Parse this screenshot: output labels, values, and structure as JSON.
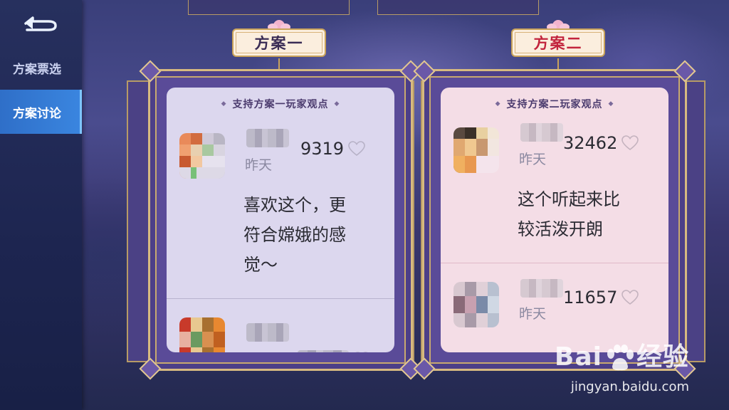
{
  "sidebar": {
    "items": [
      {
        "label": "方案票选",
        "active": false
      },
      {
        "label": "方案讨论",
        "active": true
      }
    ]
  },
  "plans": [
    {
      "title": "方案一",
      "header": "支持方案一玩家观点",
      "comments": [
        {
          "time": "昨天",
          "likes": "9319",
          "text": [
            "喜欢这个，更",
            "符合嫦娥的感",
            "觉～"
          ]
        },
        {
          "time": "",
          "likes": "",
          "text": []
        }
      ]
    },
    {
      "title": "方案二",
      "header": "支持方案二玩家观点",
      "comments": [
        {
          "time": "昨天",
          "likes": "32462",
          "text": [
            "这个听起来比",
            "较活泼开朗"
          ]
        },
        {
          "time": "昨天",
          "likes": "11657",
          "text": []
        }
      ]
    }
  ],
  "watermark": {
    "brand_left": "Bai",
    "brand_right": "经验",
    "url": "jingyan.baidu.com"
  },
  "colors": {
    "active_tab": "#3a85df",
    "plan2_title": "#c2243d",
    "frame_gold": "#d7ba80"
  },
  "icons": {
    "back": "back-arrow-icon",
    "like": "heart-outline-icon",
    "decor": "lotus-icon"
  }
}
